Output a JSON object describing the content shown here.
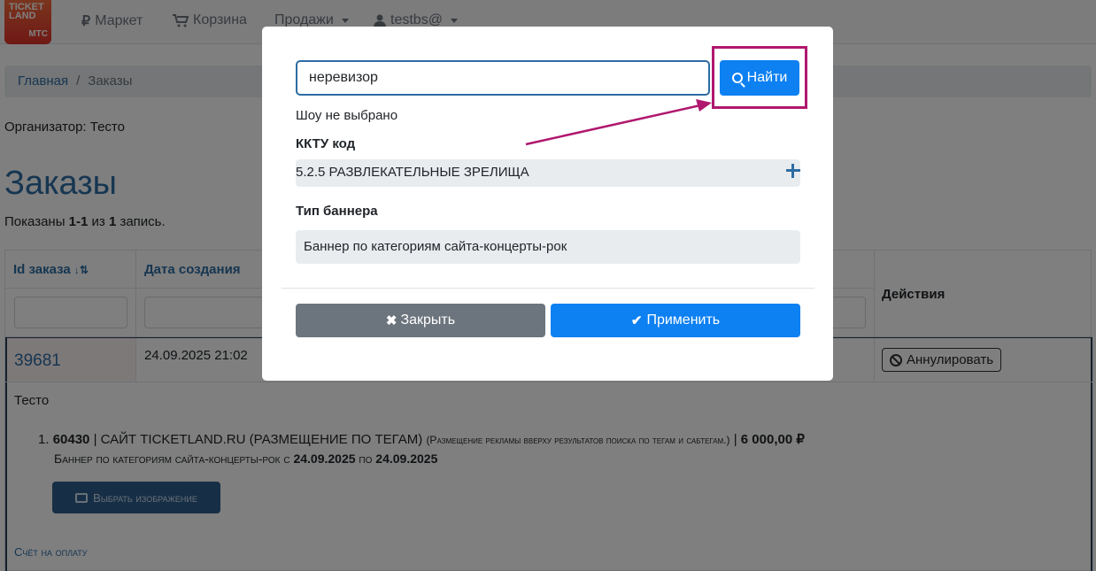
{
  "navbar": {
    "logo_line1": "TICKET",
    "logo_line2": "LAND",
    "logo_mts": "МТС",
    "market": "Маркет",
    "cart": "Корзина",
    "sales": "Продажи",
    "user": "testbs@"
  },
  "breadcrumb": {
    "home": "Главная",
    "current": "Заказы"
  },
  "organizer": "Организатор: Тесто",
  "page_title": "Заказы",
  "summary": {
    "prefix": "Показаны ",
    "range": "1-1",
    "mid": " из ",
    "count": "1",
    "suffix": " запись."
  },
  "table": {
    "col_id": "Id заказа",
    "col_date": "Дата создания",
    "col_actions": "Действия",
    "row": {
      "id": "39681",
      "date": "24.09.2025 21:02",
      "cancel_label": "Аннулировать",
      "organizer": "Тесто",
      "item_num": "1.",
      "item_id": "60430",
      "item_sep": " | ",
      "item_title": "САЙТ TICKETLAND.RU (РАЗМЕЩЕНИЕ ПО ТЕГАМ)",
      "item_desc": "(Размещение рекламы вверху результатов поиска по тегам и сабтегам.)",
      "item_price": "6 000,00 ₽",
      "banner_line_prefix": "Баннер по категориям сайта-концерты-рок с ",
      "date_from": "24.09.2025",
      "date_to_prefix": " по ",
      "date_to": "24.09.2025",
      "choose_image": "Выбрать изображение",
      "invoice": "Счёт на оплату"
    }
  },
  "modal": {
    "search_value": "неревизор",
    "find_label": "Найти",
    "show_status": "Шоу не выбрано",
    "kktu_label": "ККТУ код",
    "kktu_value": "5.2.5 РАЗВЛЕКАТЕЛЬНЫЕ ЗРЕЛИЩА",
    "banner_type_label": "Тип баннера",
    "banner_type_value": "Баннер по категориям сайта-концерты-рок",
    "close_label": "Закрыть",
    "apply_label": "Применить"
  },
  "colors": {
    "primary": "#0d80f2",
    "link": "#2d6ca3",
    "secondary": "#6c757d",
    "annotation": "#b0176e"
  }
}
